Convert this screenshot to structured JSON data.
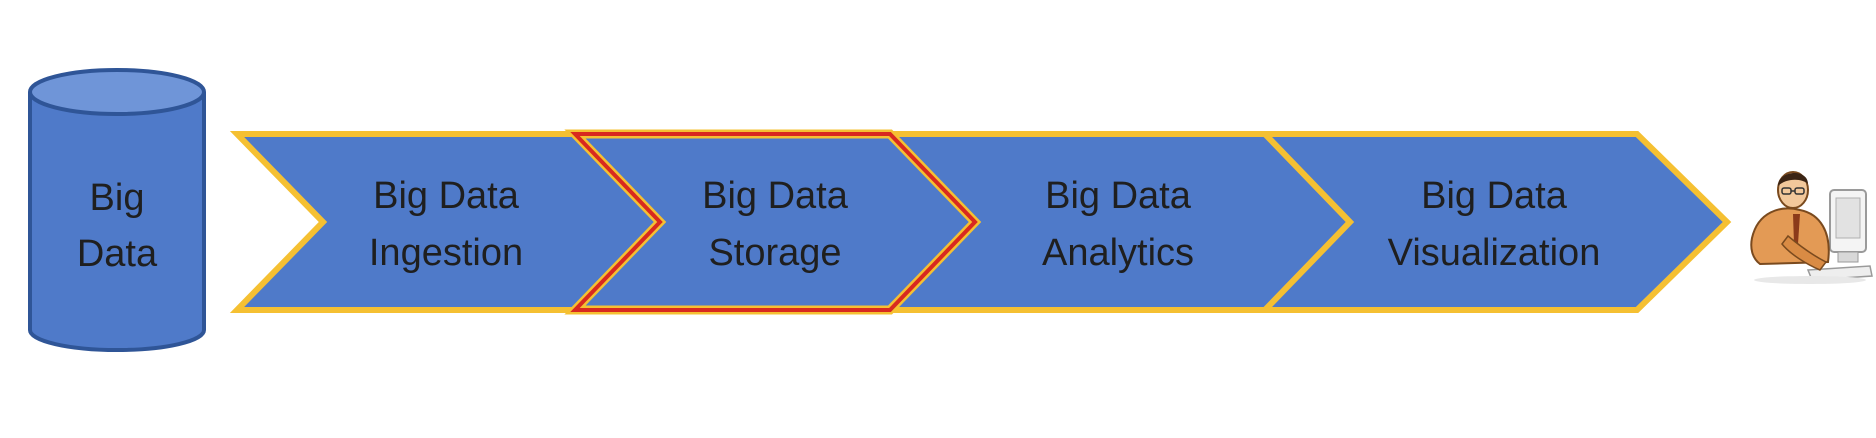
{
  "colors": {
    "shape_fill": "#4f7ac9",
    "default_outline": "#f5c032",
    "highlight_outline": "#d8291f",
    "text": "#1f1f1f",
    "cylinder_stroke": "#2f5597"
  },
  "source": {
    "line1": "Big",
    "line2": "Data"
  },
  "stages": [
    {
      "line1": "Big Data",
      "line2": "Ingestion",
      "highlighted": false
    },
    {
      "line1": "Big Data",
      "line2": "Storage",
      "highlighted": true
    },
    {
      "line1": "Big Data",
      "line2": "Analytics",
      "highlighted": false
    },
    {
      "line1": "Big Data",
      "line2": "Visualization",
      "highlighted": false
    }
  ],
  "end_icon": "user-at-computer-icon"
}
